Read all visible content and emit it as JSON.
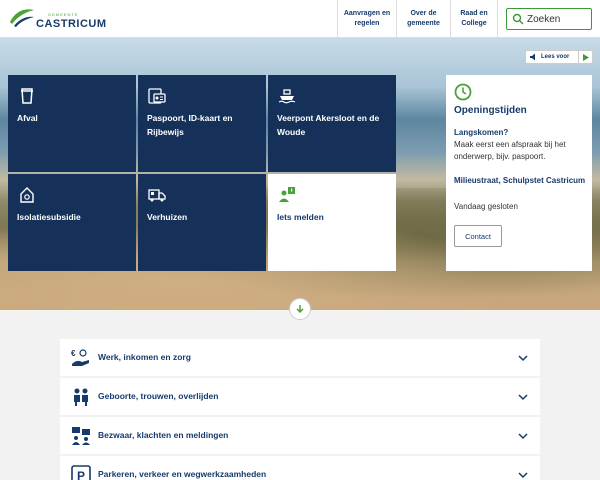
{
  "header": {
    "logo_text": "CASTRICUM",
    "logo_small": "GEMEENTE",
    "nav": [
      "Aanvragen en regelen",
      "Over de gemeente",
      "Raad en College"
    ],
    "search_placeholder": "Zoeken"
  },
  "listen": {
    "label": "Lees voor"
  },
  "tiles": [
    {
      "label": "Afval",
      "icon": "bin-icon"
    },
    {
      "label": "Paspoort, ID-kaart en Rijbewijs",
      "icon": "id-card-icon"
    },
    {
      "label": "Veerpont Akersloot en de Woude",
      "icon": "ferry-icon"
    },
    {
      "label": "Isolatiesubsidie",
      "icon": "house-insulation-icon"
    },
    {
      "label": "Verhuizen",
      "icon": "moving-truck-icon"
    },
    {
      "label": "Iets melden",
      "icon": "report-icon"
    }
  ],
  "hours": {
    "title": "Openingstijden",
    "h1": "Langskomen?",
    "p1": "Maak eerst een afspraak bij het onderwerp, bijv. paspoort.",
    "h2": "Milieustraat, Schulpstet Castricum",
    "p2": "Vandaag gesloten",
    "button": "Contact"
  },
  "accordion": [
    {
      "label": "Werk, inkomen en zorg",
      "icon": "money-hand-icon"
    },
    {
      "label": "Geboorte, trouwen, overlijden",
      "icon": "people-icon"
    },
    {
      "label": "Bezwaar, klachten en meldingen",
      "icon": "chat-people-icon"
    },
    {
      "label": "Parkeren, verkeer en wegwerkzaamheden",
      "icon": "parking-icon"
    }
  ],
  "colors": {
    "navy": "#15315a",
    "green": "#4aa338",
    "text": "#163b6b"
  }
}
